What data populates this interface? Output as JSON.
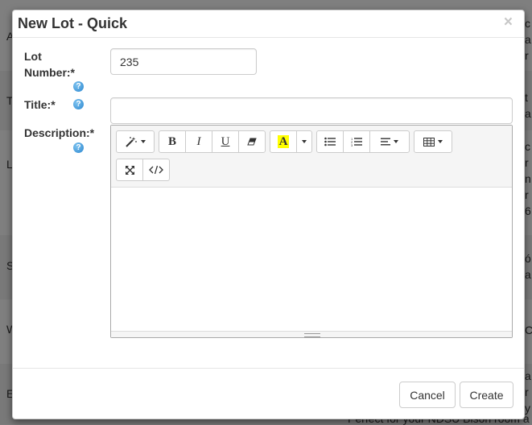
{
  "background": {
    "left_letters": [
      "A",
      "T",
      "L",
      "S",
      "W",
      "E"
    ],
    "right_fragments": [
      "c",
      "a",
      "r",
      "t",
      "a",
      "c",
      "r",
      "n",
      "r",
      "6",
      "ó",
      "a",
      "C",
      "a",
      "r",
      "y"
    ],
    "bottom_text": "Perfect for your NDSU Bison room a"
  },
  "modal": {
    "title": "New Lot - Quick",
    "close_symbol": "×",
    "fields": {
      "lot_number": {
        "label_line1": "Lot",
        "label_line2": "Number:*",
        "value": "235"
      },
      "title": {
        "label": "Title:*",
        "value": ""
      },
      "description": {
        "label": "Description:*"
      }
    },
    "help_symbol": "?",
    "toolbar": {
      "bold": "B",
      "italic": "I",
      "underline": "U",
      "color_letter": "A",
      "highlight_color": "#ffff00"
    },
    "footer": {
      "cancel": "Cancel",
      "create": "Create"
    }
  }
}
